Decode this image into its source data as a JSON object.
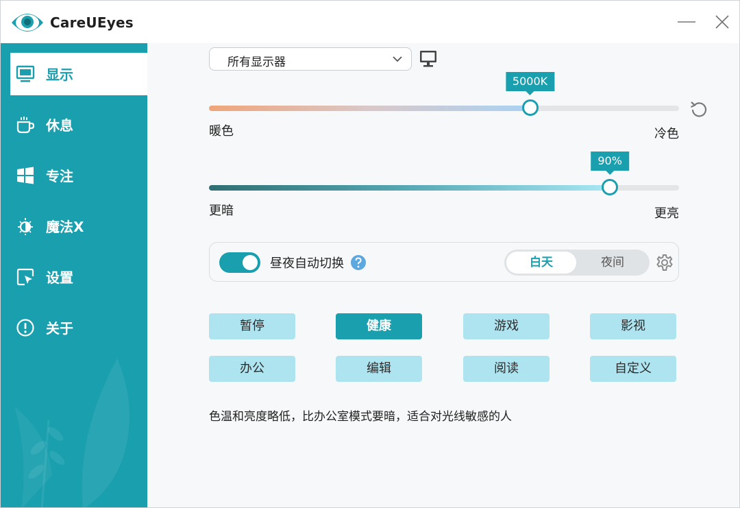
{
  "app": {
    "title": "CareUEyes"
  },
  "sidebar": {
    "items": [
      {
        "label": "显示",
        "icon": "monitor-icon",
        "active": true
      },
      {
        "label": "休息",
        "icon": "coffee-cup-icon",
        "active": false
      },
      {
        "label": "专注",
        "icon": "windows-grid-icon",
        "active": false
      },
      {
        "label": "魔法X",
        "icon": "sun-moon-icon",
        "active": false
      },
      {
        "label": "设置",
        "icon": "cursor-window-icon",
        "active": false
      },
      {
        "label": "关于",
        "icon": "info-exclamation-icon",
        "active": false
      }
    ]
  },
  "display": {
    "monitor_select": {
      "value": "所有显示器"
    },
    "temperature": {
      "value_label": "5000K",
      "fraction": 0.683,
      "min_label": "暖色",
      "max_label": "冷色"
    },
    "brightness": {
      "value_label": "90%",
      "fraction": 0.853,
      "min_label": "更暗",
      "max_label": "更亮"
    },
    "auto_switch": {
      "label": "昼夜自动切换",
      "enabled": true,
      "day_label": "白天",
      "night_label": "夜间",
      "selected": "day"
    },
    "modes": [
      {
        "label": "暂停",
        "active": false
      },
      {
        "label": "健康",
        "active": true
      },
      {
        "label": "游戏",
        "active": false
      },
      {
        "label": "影视",
        "active": false
      },
      {
        "label": "办公",
        "active": false
      },
      {
        "label": "编辑",
        "active": false
      },
      {
        "label": "阅读",
        "active": false
      },
      {
        "label": "自定义",
        "active": false
      }
    ],
    "description": "色温和亮度略低，比办公室模式要暗，适合对光线敏感的人"
  },
  "colors": {
    "accent": "#1a9fae",
    "mode_inactive": "#aee4ef",
    "background": "#f6f8f9"
  }
}
